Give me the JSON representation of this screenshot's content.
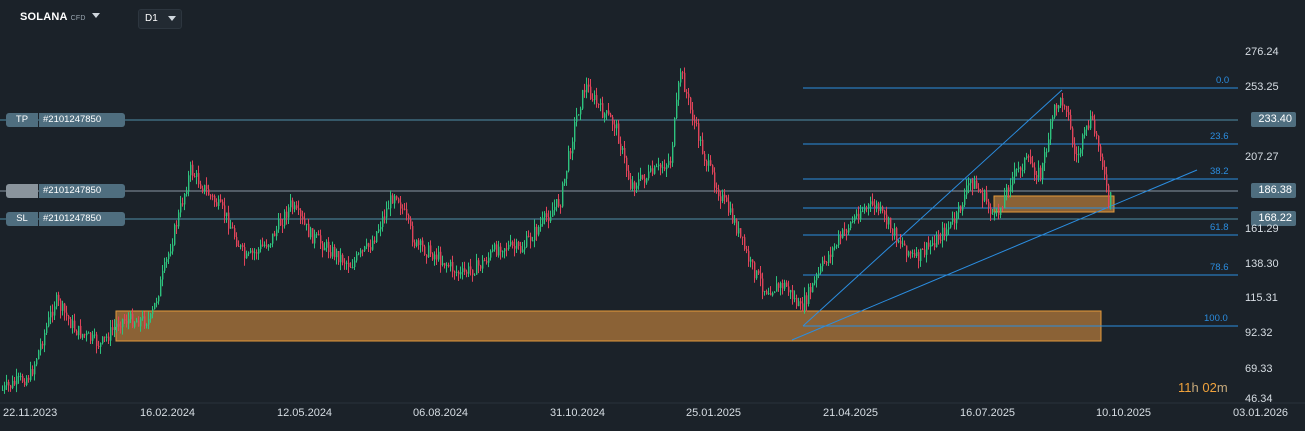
{
  "header": {
    "symbol": "SOLANA",
    "symbol_type": "CFD",
    "timeframe": "D1"
  },
  "orders": {
    "tp": {
      "label": "TP",
      "id": "#2101247850"
    },
    "entry": {
      "label": "",
      "id": "#2101247850"
    },
    "sl": {
      "label": "SL",
      "id": "#2101247850"
    }
  },
  "price_tags": {
    "tp": "233.40",
    "entry": "186.38",
    "sl": "168.22"
  },
  "y_axis": [
    "276.24",
    "253.25",
    "207.27",
    "161.29",
    "138.30",
    "115.31",
    "92.32",
    "69.33",
    "46.34"
  ],
  "x_axis": [
    "22.11.2023",
    "16.02.2024",
    "12.05.2024",
    "06.08.2024",
    "31.10.2024",
    "25.01.2025",
    "21.04.2025",
    "16.07.2025",
    "10.10.2025",
    "03.01.2026"
  ],
  "fib_levels": [
    "0.0",
    "23.6",
    "38.2",
    "61.8",
    "78.6",
    "100.0"
  ],
  "countdown": {
    "hours": "11",
    "h_unit": "h",
    "minutes": "02",
    "m_unit": "m"
  },
  "colors": {
    "background": "#1b2229",
    "bull": "#2ec27e",
    "bear": "#e0445a",
    "zone_fill": "#8b6236",
    "zone_border": "#e69a3a",
    "fib_line": "#2b8de0",
    "order_line": "#4f8fa8",
    "tag": "#4f6e7f"
  }
}
